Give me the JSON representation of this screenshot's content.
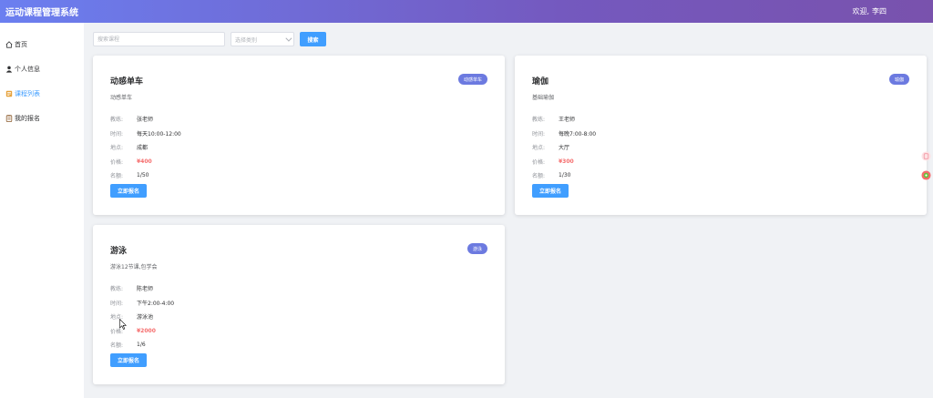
{
  "header": {
    "title": "运动课程管理系统",
    "welcome": "欢迎,",
    "user": "李四"
  },
  "sidebar": {
    "items": [
      {
        "label": "首页",
        "icon": "home-icon"
      },
      {
        "label": "个人信息",
        "icon": "user-icon"
      },
      {
        "label": "课程列表",
        "icon": "course-list-icon",
        "active": true
      },
      {
        "label": "我的报名",
        "icon": "my-enrollment-icon"
      }
    ]
  },
  "toolbar": {
    "search_placeholder": "搜索课程",
    "select_placeholder": "选择类别",
    "search_label": "搜索"
  },
  "labels": {
    "coach": "教练:",
    "time": "时间:",
    "location": "地点:",
    "price": "价格:",
    "quota": "名额:"
  },
  "enroll_label": "立即报名",
  "courses": [
    {
      "title": "动感单车",
      "tag": "动感单车",
      "desc": "动感单车",
      "coach": "张老师",
      "time": "每天10:00-12:00",
      "location": "成都",
      "price": "¥400",
      "quota": "1/50"
    },
    {
      "title": "瑜伽",
      "tag": "瑜伽",
      "desc": "基础瑜伽",
      "coach": "王老师",
      "time": "每晚7:00-8:00",
      "location": "大厅",
      "price": "¥300",
      "quota": "1/30"
    },
    {
      "title": "游泳",
      "tag": "游泳",
      "desc": "游泳12节课,包学会",
      "coach": "陈老师",
      "time": "下午2:00-4:00",
      "location": "游泳池",
      "price": "¥2000",
      "quota": "1/6"
    }
  ],
  "colors": {
    "primary": "#409eff",
    "tag": "#6c7ae0",
    "price": "#f56c6c",
    "header_start": "#6b7ff0",
    "header_end": "#7952ad"
  }
}
